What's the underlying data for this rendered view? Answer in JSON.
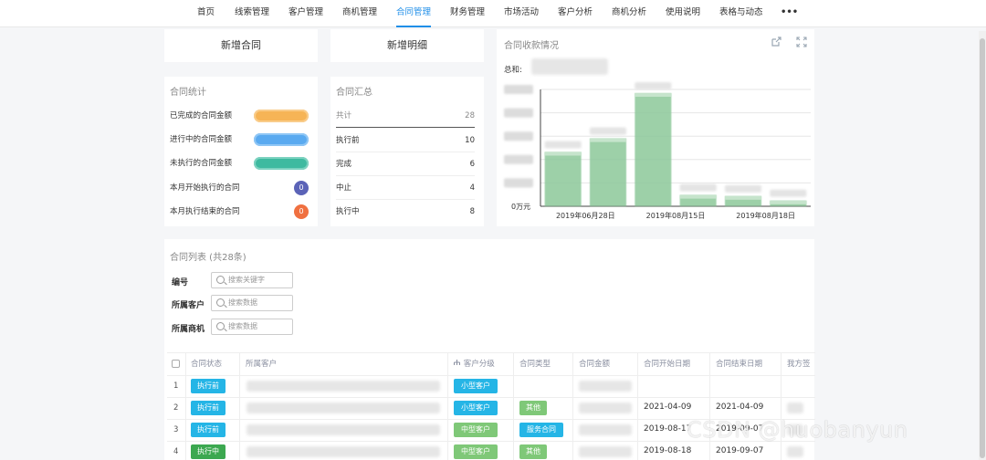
{
  "nav": {
    "items": [
      {
        "label": "首页",
        "active": false
      },
      {
        "label": "线索管理",
        "active": false
      },
      {
        "label": "客户管理",
        "active": false
      },
      {
        "label": "商机管理",
        "active": false
      },
      {
        "label": "合同管理",
        "active": true
      },
      {
        "label": "财务管理",
        "active": false
      },
      {
        "label": "市场活动",
        "active": false
      },
      {
        "label": "客户分析",
        "active": false
      },
      {
        "label": "商机分析",
        "active": false
      },
      {
        "label": "使用说明",
        "active": false
      },
      {
        "label": "表格与动态",
        "active": false
      }
    ],
    "more": "•••"
  },
  "actions": {
    "new_contract": "新增合同",
    "new_detail": "新增明细"
  },
  "stats": {
    "title": "合同统计",
    "rows": [
      {
        "label": "已完成的合同金额",
        "color": "#f6b456"
      },
      {
        "label": "进行中的合同金额",
        "color": "#5aaaf0"
      },
      {
        "label": "未执行的合同金额",
        "color": "#3ebaa0"
      },
      {
        "label": "本月开始执行的合同",
        "count": "0",
        "color": "#5b63b7"
      },
      {
        "label": "本月执行结束的合同",
        "count": "0",
        "color": "#f07040"
      }
    ]
  },
  "summary": {
    "title": "合同汇总",
    "head": {
      "label": "共计",
      "value": "28"
    },
    "rows": [
      {
        "label": "执行前",
        "value": "10"
      },
      {
        "label": "完成",
        "value": "6"
      },
      {
        "label": "中止",
        "value": "4"
      },
      {
        "label": "执行中",
        "value": "8"
      }
    ]
  },
  "payment": {
    "title": "合同收款情况",
    "total_label": "总和:",
    "zero_label": "0万元",
    "icons": {
      "export": "export-icon",
      "expand": "expand-icon"
    },
    "chart_data": {
      "type": "bar",
      "categories": [
        "2019年06月28日",
        "",
        "2019年08月15日",
        "",
        "2019年08月18日",
        ""
      ],
      "values": [
        48,
        60,
        100,
        10,
        9,
        5
      ],
      "x_tick_labels": [
        "2019年06月28日",
        "2019年08月15日",
        "2019年08月18日"
      ],
      "ylabel_zero": "0万元",
      "bar_color": "#8cc89a",
      "grid": true
    }
  },
  "list": {
    "title": "合同列表 (共28条)",
    "filters": [
      {
        "label": "编号",
        "placeholder": "搜索关键字"
      },
      {
        "label": "所属客户",
        "placeholder": "搜索数据"
      },
      {
        "label": "所属商机",
        "placeholder": "搜索数据"
      }
    ],
    "columns": [
      "合同状态",
      "所属客户",
      "客户分级",
      "合同类型",
      "合同金额",
      "合同开始日期",
      "合同结束日期",
      "我方签"
    ],
    "rows": [
      {
        "n": "1",
        "status": "执行前",
        "status_color": "blue",
        "level": "小型客户",
        "level_color": "blue",
        "type": "",
        "type_color": "",
        "start": "",
        "end": ""
      },
      {
        "n": "2",
        "status": "执行前",
        "status_color": "blue",
        "level": "小型客户",
        "level_color": "blue",
        "type": "其他",
        "type_color": "green",
        "start": "2021-04-09",
        "end": "2021-04-09"
      },
      {
        "n": "3",
        "status": "执行前",
        "status_color": "blue",
        "level": "中型客户",
        "level_color": "green",
        "type": "服务合同",
        "type_color": "blue",
        "start": "2019-08-17",
        "end": "2019-09-07"
      },
      {
        "n": "4",
        "status": "执行中",
        "status_color": "dark",
        "level": "中型客户",
        "level_color": "green",
        "type": "其他",
        "type_color": "green",
        "start": "2019-08-18",
        "end": "2019-09-07"
      }
    ]
  },
  "watermark": "CSDN @huobanyun"
}
